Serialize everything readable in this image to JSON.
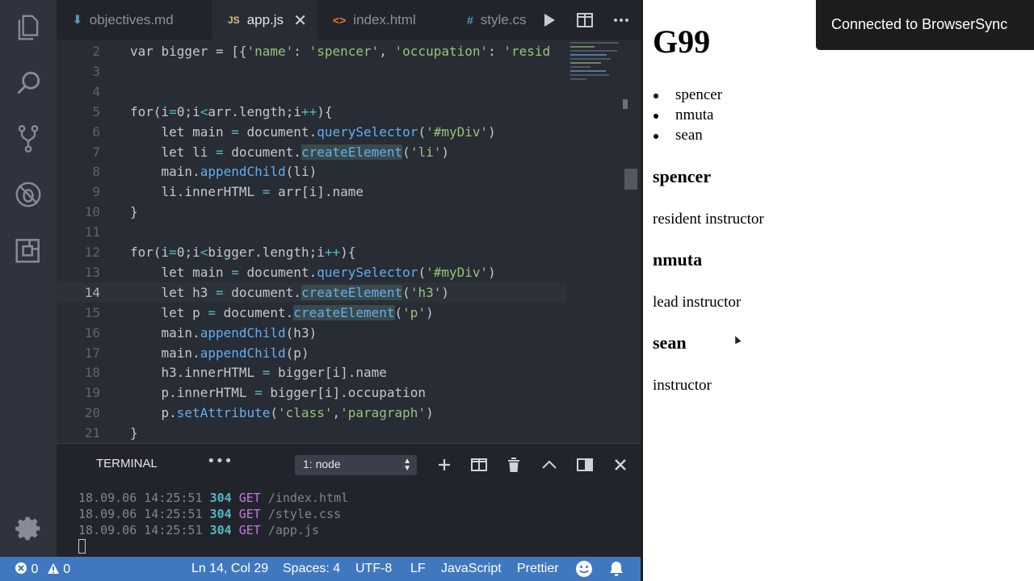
{
  "editor": {
    "tabs": [
      {
        "icon": "markdown-icon",
        "icon_glyph": "⬇",
        "label": "objectives.md"
      },
      {
        "icon": "js-icon",
        "icon_glyph": "JS",
        "label": "app.js",
        "close": "✕"
      },
      {
        "icon": "html-icon",
        "icon_glyph": "<>",
        "label": "index.html"
      },
      {
        "icon": "css-icon",
        "icon_glyph": "#",
        "label": "style.cs"
      }
    ],
    "code_lines": [
      {
        "n": "2",
        "html": "var bigger = [{<span class='str'>'name'</span>: <span class='str'>'spencer'</span>, <span class='str'>'occupation'</span>: <span class='str'>'resid</span>"
      },
      {
        "n": "3",
        "html": ""
      },
      {
        "n": "4",
        "html": ""
      },
      {
        "n": "5",
        "html": "for(i<span class='op'>=</span>0;i<span class='op'>&lt;</span>arr.length;i<span class='op'>++</span>){"
      },
      {
        "n": "6",
        "html": "    let main <span class='op'>=</span> document.<span class='fn'>querySelector</span>(<span class='str'>'#myDiv'</span>)"
      },
      {
        "n": "7",
        "html": "    let li <span class='op'>=</span> document.<span class='fn hl'>createElement</span>(<span class='str'>'li'</span>)"
      },
      {
        "n": "8",
        "html": "    main.<span class='fn'>appendChild</span>(li)"
      },
      {
        "n": "9",
        "html": "    li.innerHTML <span class='op'>=</span> arr[i].name"
      },
      {
        "n": "10",
        "html": "}"
      },
      {
        "n": "11",
        "html": ""
      },
      {
        "n": "12",
        "html": "for(i<span class='op'>=</span>0;i<span class='op'>&lt;</span>bigger.length;i<span class='op'>++</span>){"
      },
      {
        "n": "13",
        "html": "    let main <span class='op'>=</span> document.<span class='fn'>querySelector</span>(<span class='str'>'#myDiv'</span>)"
      },
      {
        "n": "14",
        "html": "    let h3 <span class='op'>=</span> document.<span class='fn hl'>createElement</span>(<span class='str'>'h3'</span>)"
      },
      {
        "n": "15",
        "html": "    let p <span class='op'>=</span> document.<span class='fn hl'>createElement</span>(<span class='str'>'p'</span>)"
      },
      {
        "n": "16",
        "html": "    main.<span class='fn'>appendChild</span>(h3)"
      },
      {
        "n": "17",
        "html": "    main.<span class='fn'>appendChild</span>(p)"
      },
      {
        "n": "18",
        "html": "    h3.innerHTML <span class='op'>=</span> bigger[i].name"
      },
      {
        "n": "19",
        "html": "    p.innerHTML <span class='op'>=</span> bigger[i].occupation"
      },
      {
        "n": "20",
        "html": "    p.<span class='fn'>setAttribute</span>(<span class='str'>'class'</span>,<span class='str'>'paragraph'</span>)"
      },
      {
        "n": "21",
        "html": "}"
      }
    ],
    "current_line": "14"
  },
  "terminal": {
    "title": "TERMINAL",
    "more": "•••",
    "select_value": "1: node",
    "log": [
      {
        "time": "18.09.06 14:25:51",
        "code": "304",
        "method": "GET",
        "path": "/index.html"
      },
      {
        "time": "18.09.06 14:25:51",
        "code": "304",
        "method": "GET",
        "path": "/style.css"
      },
      {
        "time": "18.09.06 14:25:51",
        "code": "304",
        "method": "GET",
        "path": "/app.js"
      }
    ]
  },
  "statusbar": {
    "errors": "0",
    "warnings": "0",
    "position": "Ln 14, Col 29",
    "spaces": "Spaces: 4",
    "encoding": "UTF-8",
    "eol": "LF",
    "language": "JavaScript",
    "formatter": "Prettier"
  },
  "browser": {
    "title": "G99",
    "list": [
      "spencer",
      "nmuta",
      "sean"
    ],
    "people": [
      {
        "name": "spencer",
        "occupation": "resident instructor"
      },
      {
        "name": "nmuta",
        "occupation": "lead instructor"
      },
      {
        "name": "sean",
        "occupation": "instructor"
      }
    ],
    "toast": "Connected to BrowserSync"
  },
  "colors": {
    "editor_bg": "#282c34",
    "statusbar_bg": "#4078c0",
    "string": "#98c379",
    "function": "#61afef"
  }
}
